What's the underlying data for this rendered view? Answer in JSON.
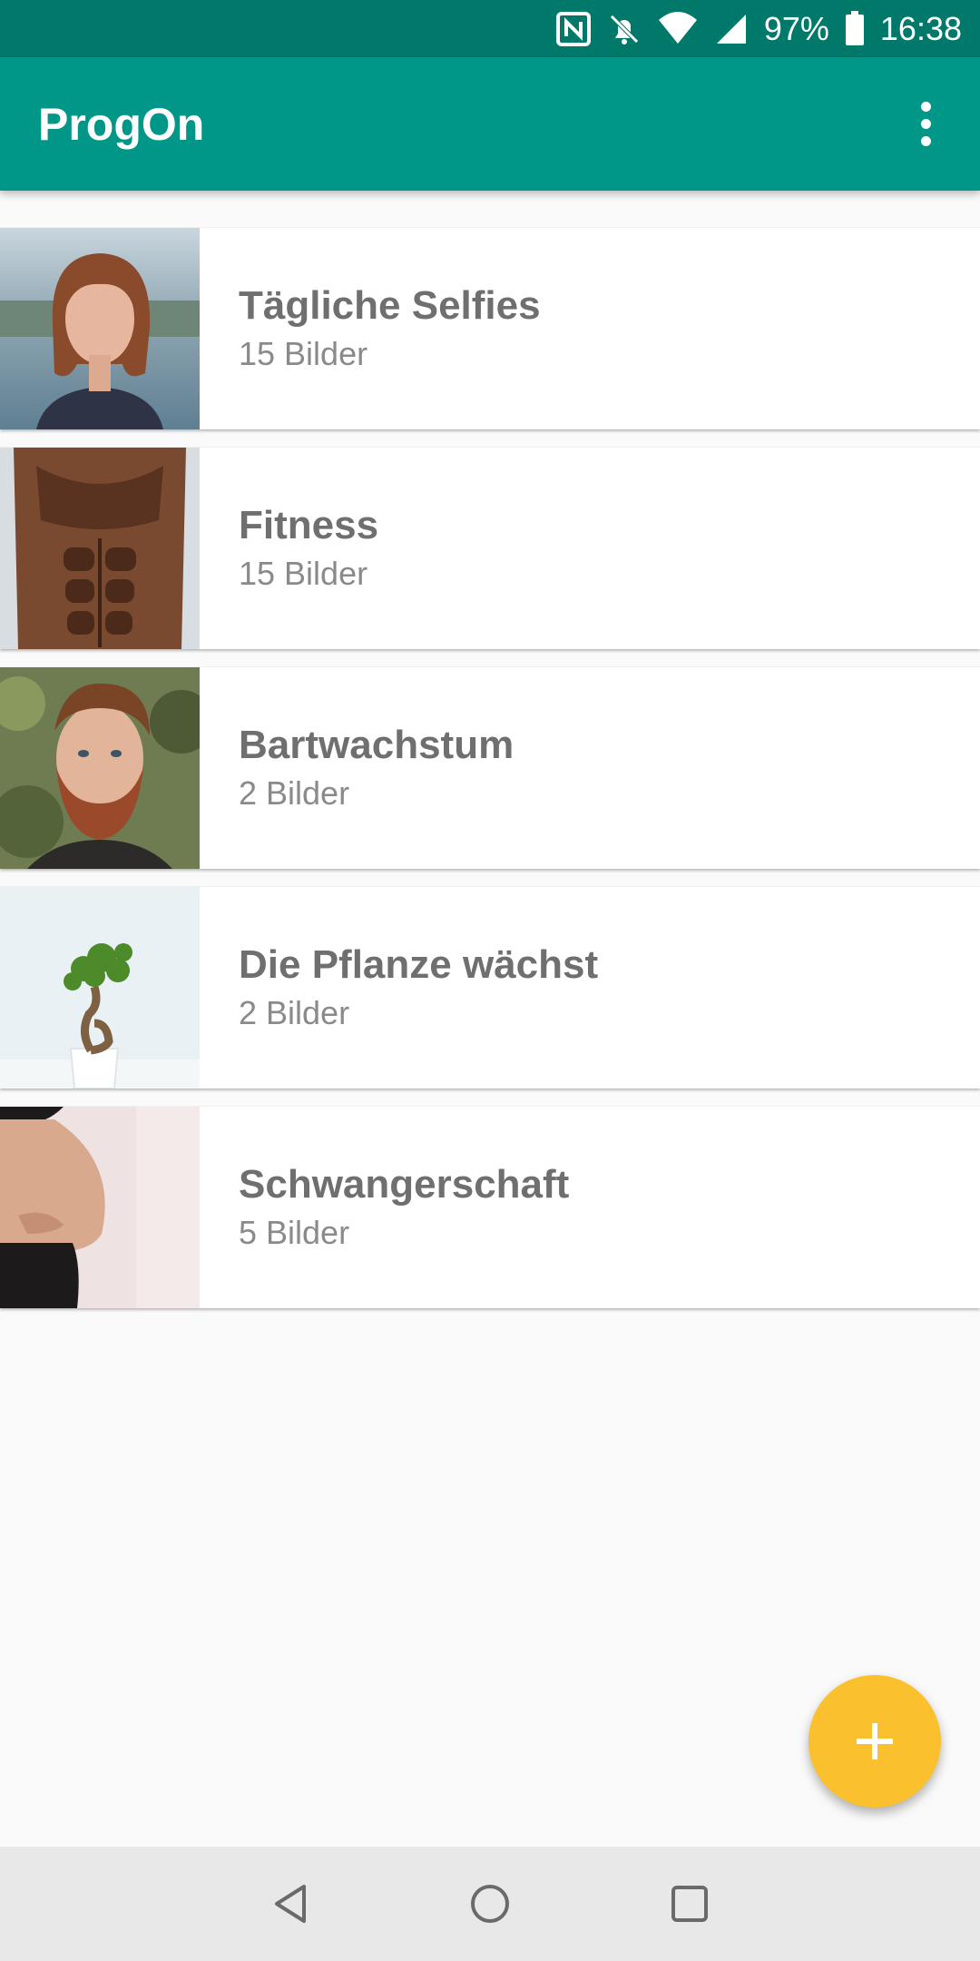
{
  "status_bar": {
    "battery": "97%",
    "time": "16:38",
    "icons": [
      "nfc-icon",
      "bell-off-icon",
      "wifi-icon",
      "signal-icon",
      "battery-icon"
    ]
  },
  "app_bar": {
    "title": "ProgOn",
    "menu_icon": "more-vert-icon"
  },
  "albums": [
    {
      "title": "Tägliche Selfies",
      "count": "15 Bilder",
      "thumb": "woman-portrait"
    },
    {
      "title": "Fitness",
      "count": "15 Bilder",
      "thumb": "torso"
    },
    {
      "title": "Bartwachstum",
      "count": "2 Bilder",
      "thumb": "bearded-man"
    },
    {
      "title": "Die Pflanze wächst",
      "count": "2 Bilder",
      "thumb": "bonsai-plant"
    },
    {
      "title": "Schwangerschaft",
      "count": "5 Bilder",
      "thumb": "pregnant-belly"
    }
  ],
  "fab": {
    "icon": "plus-icon"
  },
  "nav_bar": {
    "icons": [
      "back-icon",
      "home-icon",
      "recents-icon"
    ]
  },
  "colors": {
    "primary": "#009688",
    "primary_dark": "#00796b",
    "accent": "#fbc02d"
  }
}
